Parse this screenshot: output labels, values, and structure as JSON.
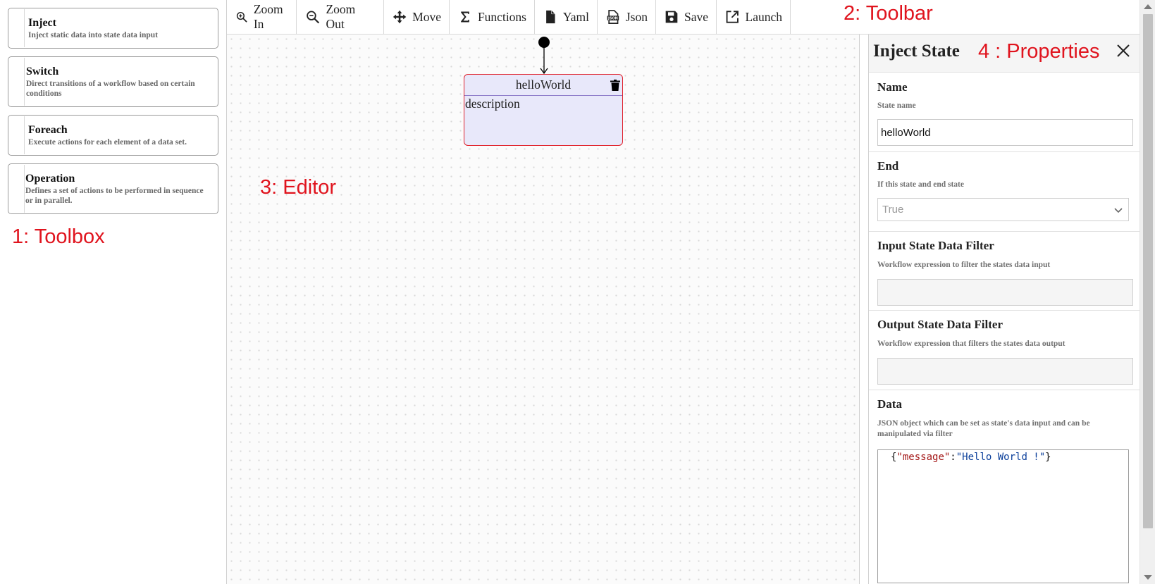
{
  "toolbox": {
    "items": [
      {
        "title": "Inject",
        "description": "Inject static data into state data input"
      },
      {
        "title": "Switch",
        "description": "Direct transitions of a workflow based on certain conditions"
      },
      {
        "title": "Foreach",
        "description": "Execute actions for each element of a data set."
      },
      {
        "title": "Operation",
        "description": "Defines a set of actions to be performed in sequence or in parallel."
      }
    ]
  },
  "toolbar": {
    "buttons": [
      {
        "label": "Zoom In",
        "icon": "zoom-in-icon"
      },
      {
        "label": "Zoom Out",
        "icon": "zoom-out-icon"
      },
      {
        "label": "Move",
        "icon": "move-icon"
      },
      {
        "label": "Functions",
        "icon": "sigma-icon"
      },
      {
        "label": "Yaml",
        "icon": "file-icon"
      },
      {
        "label": "Json",
        "icon": "json-file-icon"
      },
      {
        "label": "Save",
        "icon": "floppy-disk-icon"
      },
      {
        "label": "Launch",
        "icon": "external-link-icon"
      }
    ]
  },
  "editor": {
    "node": {
      "name": "helloWorld",
      "description": "description"
    }
  },
  "properties": {
    "title": "Inject State",
    "name": {
      "label": "Name",
      "hint": "State name",
      "value": "helloWorld"
    },
    "end": {
      "label": "End",
      "hint": "If this state and end state",
      "value": "True"
    },
    "input_filter": {
      "label": "Input State Data Filter",
      "hint": "Workflow expression to filter the states data input",
      "value": ""
    },
    "output_filter": {
      "label": "Output State Data Filter",
      "hint": "Workflow expression that filters the states data output",
      "value": ""
    },
    "data": {
      "label": "Data",
      "hint": "JSON object which can be set as state's data input and can be manipulated via filter",
      "json": {
        "open": "{",
        "key": "\"message\"",
        "colon": ":",
        "value": "\"Hello World !\"",
        "close": "}"
      }
    }
  },
  "annotations": {
    "toolbox": "1: Toolbox",
    "toolbar": "2: Toolbar",
    "editor": "3: Editor",
    "properties": "4 : Properties"
  },
  "colors": {
    "annotation": "#e0141e",
    "node_border": "#e0202a",
    "node_fill": "#e8e8fa",
    "json_key": "#a31515",
    "json_value": "#0a3e9a"
  }
}
